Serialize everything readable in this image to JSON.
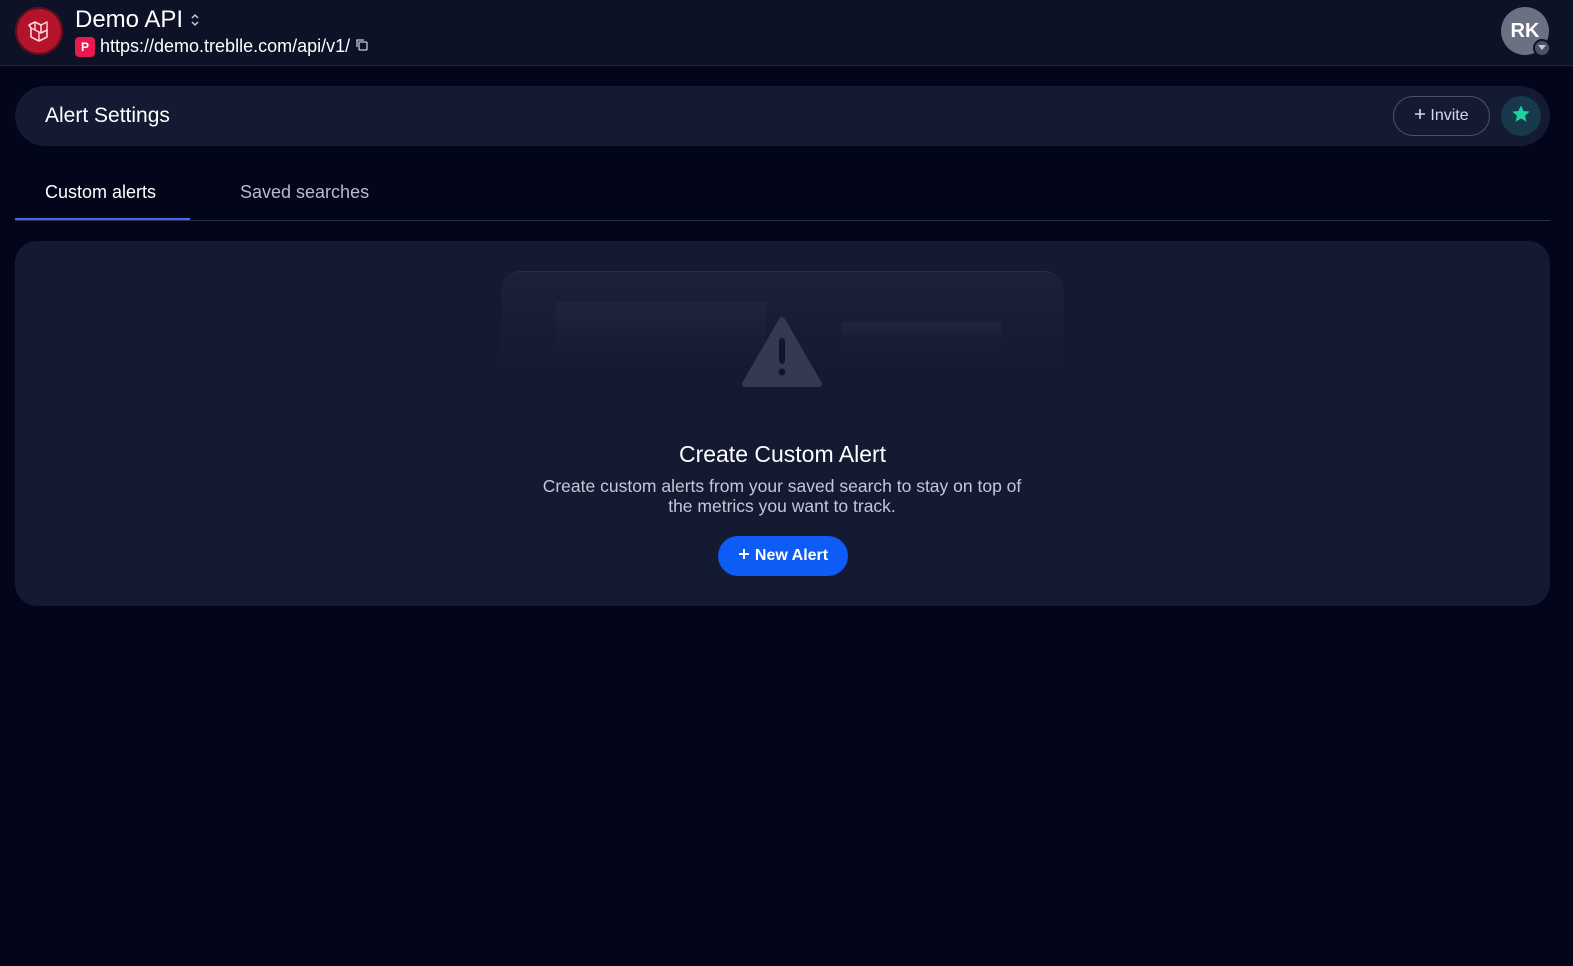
{
  "header": {
    "api_name": "Demo API",
    "platform_badge": "P",
    "api_url": "https://demo.treblle.com/api/v1/",
    "avatar_initials": "RK"
  },
  "page": {
    "title": "Alert Settings",
    "invite_label": "Invite"
  },
  "tabs": [
    {
      "label": "Custom alerts",
      "active": true
    },
    {
      "label": "Saved searches",
      "active": false
    }
  ],
  "empty_state": {
    "title": "Create Custom Alert",
    "description": "Create custom alerts from your saved search to stay on top of the metrics you want to track.",
    "button_label": "New Alert"
  },
  "icons": [
    "app-logo-icon",
    "sort-icon",
    "copy-icon",
    "avatar-caret-icon",
    "plus-icon",
    "star-icon",
    "warning-icon"
  ],
  "colors": {
    "background": "#03061a",
    "card": "#141a31",
    "accent": "#0d5cf5",
    "logo": "#b3142b",
    "star": "#1fd1a0",
    "badge": "#e8194f"
  }
}
